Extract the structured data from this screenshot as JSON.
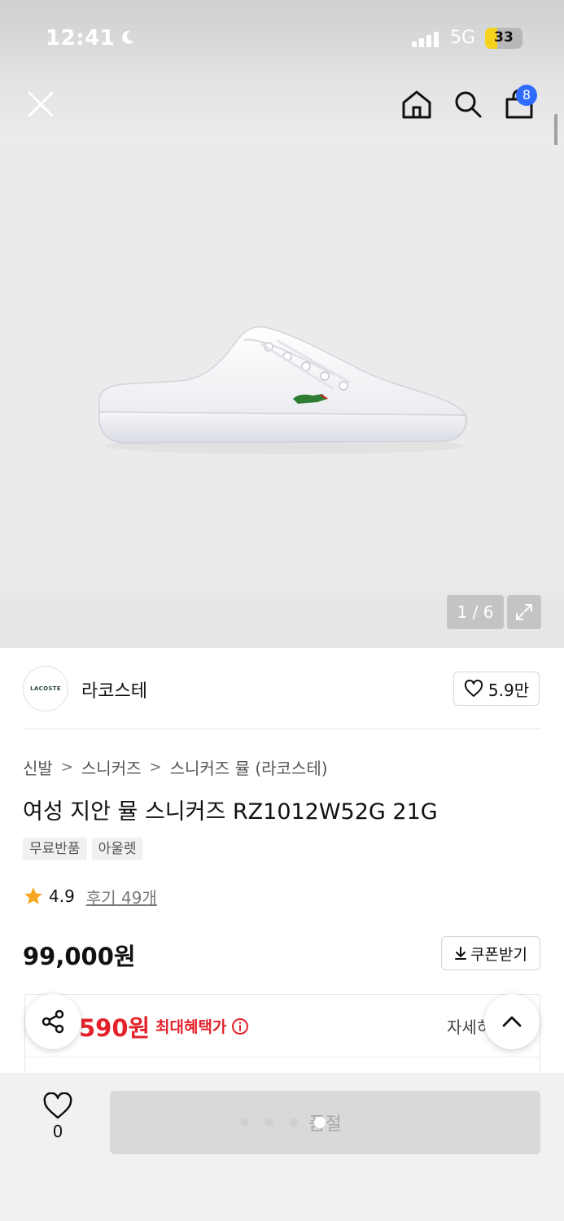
{
  "status_bar": {
    "time": "12:41",
    "network": "5G",
    "battery": "33",
    "battery_level": 0.33
  },
  "nav": {
    "cart_badge": "8"
  },
  "gallery": {
    "counter": "1 / 6"
  },
  "brand": {
    "logo_text": "LACOSTE",
    "name": "라코스테",
    "like_count": "5.9만"
  },
  "breadcrumb": {
    "items": [
      "신발",
      "스니커즈",
      "스니커즈 뮬 (라코스테)"
    ]
  },
  "product": {
    "title": "여성 지안 뮬 스니커즈 RZ1012W52G 21G",
    "tags": [
      "무료반품",
      "아울렛"
    ],
    "rating": "4.9",
    "review_link": "후기 49개",
    "price": "99,000원",
    "coupon_label": "쿠폰받기"
  },
  "benefit": {
    "price": "590원",
    "label": "최대혜택가",
    "detail_link": "자세히"
  },
  "bottom_bar": {
    "wish_count": "0",
    "soldout_label": "품절"
  },
  "colors": {
    "accent_blue": "#2f6bff",
    "benefit_red": "#e3222b",
    "star_orange": "#f5a623"
  }
}
